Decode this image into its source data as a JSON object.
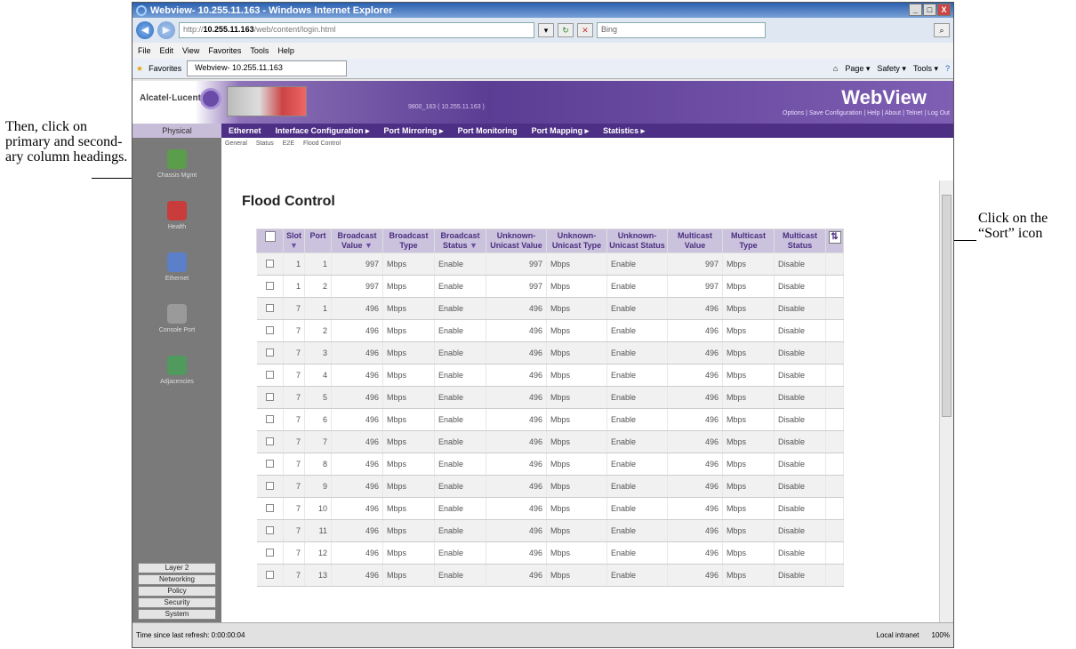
{
  "annotations": {
    "left": "Then, click on primary and second- ary column headings.",
    "right": "Click on the “Sort” icon"
  },
  "browser": {
    "title": "Webview- 10.255.11.163 - Windows Internet Explorer",
    "url_prefix": "http://",
    "url_host": "10.255.11.163",
    "url_path": "/web/content/login.html",
    "search_placeholder": "Bing",
    "menu": [
      "File",
      "Edit",
      "View",
      "Favorites",
      "Tools",
      "Help"
    ],
    "favorites_label": "Favorites",
    "tab_label": "Webview- 10.255.11.163",
    "toolbar_right": [
      "Page ▾",
      "Safety ▾",
      "Tools ▾"
    ],
    "window_buttons": [
      "_",
      "□",
      "X"
    ]
  },
  "app": {
    "brand": "Alcatel·Lucent",
    "webview": "WebView",
    "hostname": "9800_163 ( 10.255.11.163 )",
    "header_links": "Options | Save Configuration | Help | About | Telnet | Log Out",
    "physical_tab": "Physical",
    "nav": [
      "Ethernet",
      "Interface Configuration ▸",
      "Port Mirroring ▸",
      "Port Monitoring",
      "Port Mapping ▸",
      "Statistics ▸"
    ],
    "subtabs": [
      "General",
      "Status",
      "E2E",
      "Flood Control"
    ],
    "sidebar": [
      {
        "label": "Chassis Mgmt",
        "icon": "chassis-icon",
        "color": "#5a9d4a"
      },
      {
        "label": "Health",
        "icon": "health-icon",
        "color": "#c83c3c"
      },
      {
        "label": "Ethernet",
        "icon": "ethernet-icon",
        "color": "#5b7fc9"
      },
      {
        "label": "Console Port",
        "icon": "console-port-icon",
        "color": "#9a9a9a"
      },
      {
        "label": "Adjacencies",
        "icon": "adjacencies-icon",
        "color": "#4f9a5c"
      }
    ],
    "sidebar_bottom": [
      "Layer 2",
      "Networking",
      "Policy",
      "Security",
      "System"
    ]
  },
  "page": {
    "title": "Flood Control",
    "headers": [
      "Slot",
      "Port",
      "Broadcast Value",
      "Broadcast Type",
      "Broadcast Status",
      "Unknown-Unicast Value",
      "Unknown-Unicast Type",
      "Unknown-Unicast Status",
      "Multicast Value",
      "Multicast Type",
      "Multicast Status"
    ],
    "sort_triangle": "▼",
    "rows": [
      [
        "1",
        "1",
        "997",
        "Mbps",
        "Enable",
        "997",
        "Mbps",
        "Enable",
        "997",
        "Mbps",
        "Disable"
      ],
      [
        "1",
        "2",
        "997",
        "Mbps",
        "Enable",
        "997",
        "Mbps",
        "Enable",
        "997",
        "Mbps",
        "Disable"
      ],
      [
        "7",
        "1",
        "496",
        "Mbps",
        "Enable",
        "496",
        "Mbps",
        "Enable",
        "496",
        "Mbps",
        "Disable"
      ],
      [
        "7",
        "2",
        "496",
        "Mbps",
        "Enable",
        "496",
        "Mbps",
        "Enable",
        "496",
        "Mbps",
        "Disable"
      ],
      [
        "7",
        "3",
        "496",
        "Mbps",
        "Enable",
        "496",
        "Mbps",
        "Enable",
        "496",
        "Mbps",
        "Disable"
      ],
      [
        "7",
        "4",
        "496",
        "Mbps",
        "Enable",
        "496",
        "Mbps",
        "Enable",
        "496",
        "Mbps",
        "Disable"
      ],
      [
        "7",
        "5",
        "496",
        "Mbps",
        "Enable",
        "496",
        "Mbps",
        "Enable",
        "496",
        "Mbps",
        "Disable"
      ],
      [
        "7",
        "6",
        "496",
        "Mbps",
        "Enable",
        "496",
        "Mbps",
        "Enable",
        "496",
        "Mbps",
        "Disable"
      ],
      [
        "7",
        "7",
        "496",
        "Mbps",
        "Enable",
        "496",
        "Mbps",
        "Enable",
        "496",
        "Mbps",
        "Disable"
      ],
      [
        "7",
        "8",
        "496",
        "Mbps",
        "Enable",
        "496",
        "Mbps",
        "Enable",
        "496",
        "Mbps",
        "Disable"
      ],
      [
        "7",
        "9",
        "496",
        "Mbps",
        "Enable",
        "496",
        "Mbps",
        "Enable",
        "496",
        "Mbps",
        "Disable"
      ],
      [
        "7",
        "10",
        "496",
        "Mbps",
        "Enable",
        "496",
        "Mbps",
        "Enable",
        "496",
        "Mbps",
        "Disable"
      ],
      [
        "7",
        "11",
        "496",
        "Mbps",
        "Enable",
        "496",
        "Mbps",
        "Enable",
        "496",
        "Mbps",
        "Disable"
      ],
      [
        "7",
        "12",
        "496",
        "Mbps",
        "Enable",
        "496",
        "Mbps",
        "Enable",
        "496",
        "Mbps",
        "Disable"
      ],
      [
        "7",
        "13",
        "496",
        "Mbps",
        "Enable",
        "496",
        "Mbps",
        "Enable",
        "496",
        "Mbps",
        "Disable"
      ]
    ],
    "sorted_columns": [
      0,
      2,
      4
    ]
  },
  "status": {
    "left": "Time since last refresh: 0:00:00:04",
    "zone": "Local intranet",
    "zoom": "100%"
  }
}
